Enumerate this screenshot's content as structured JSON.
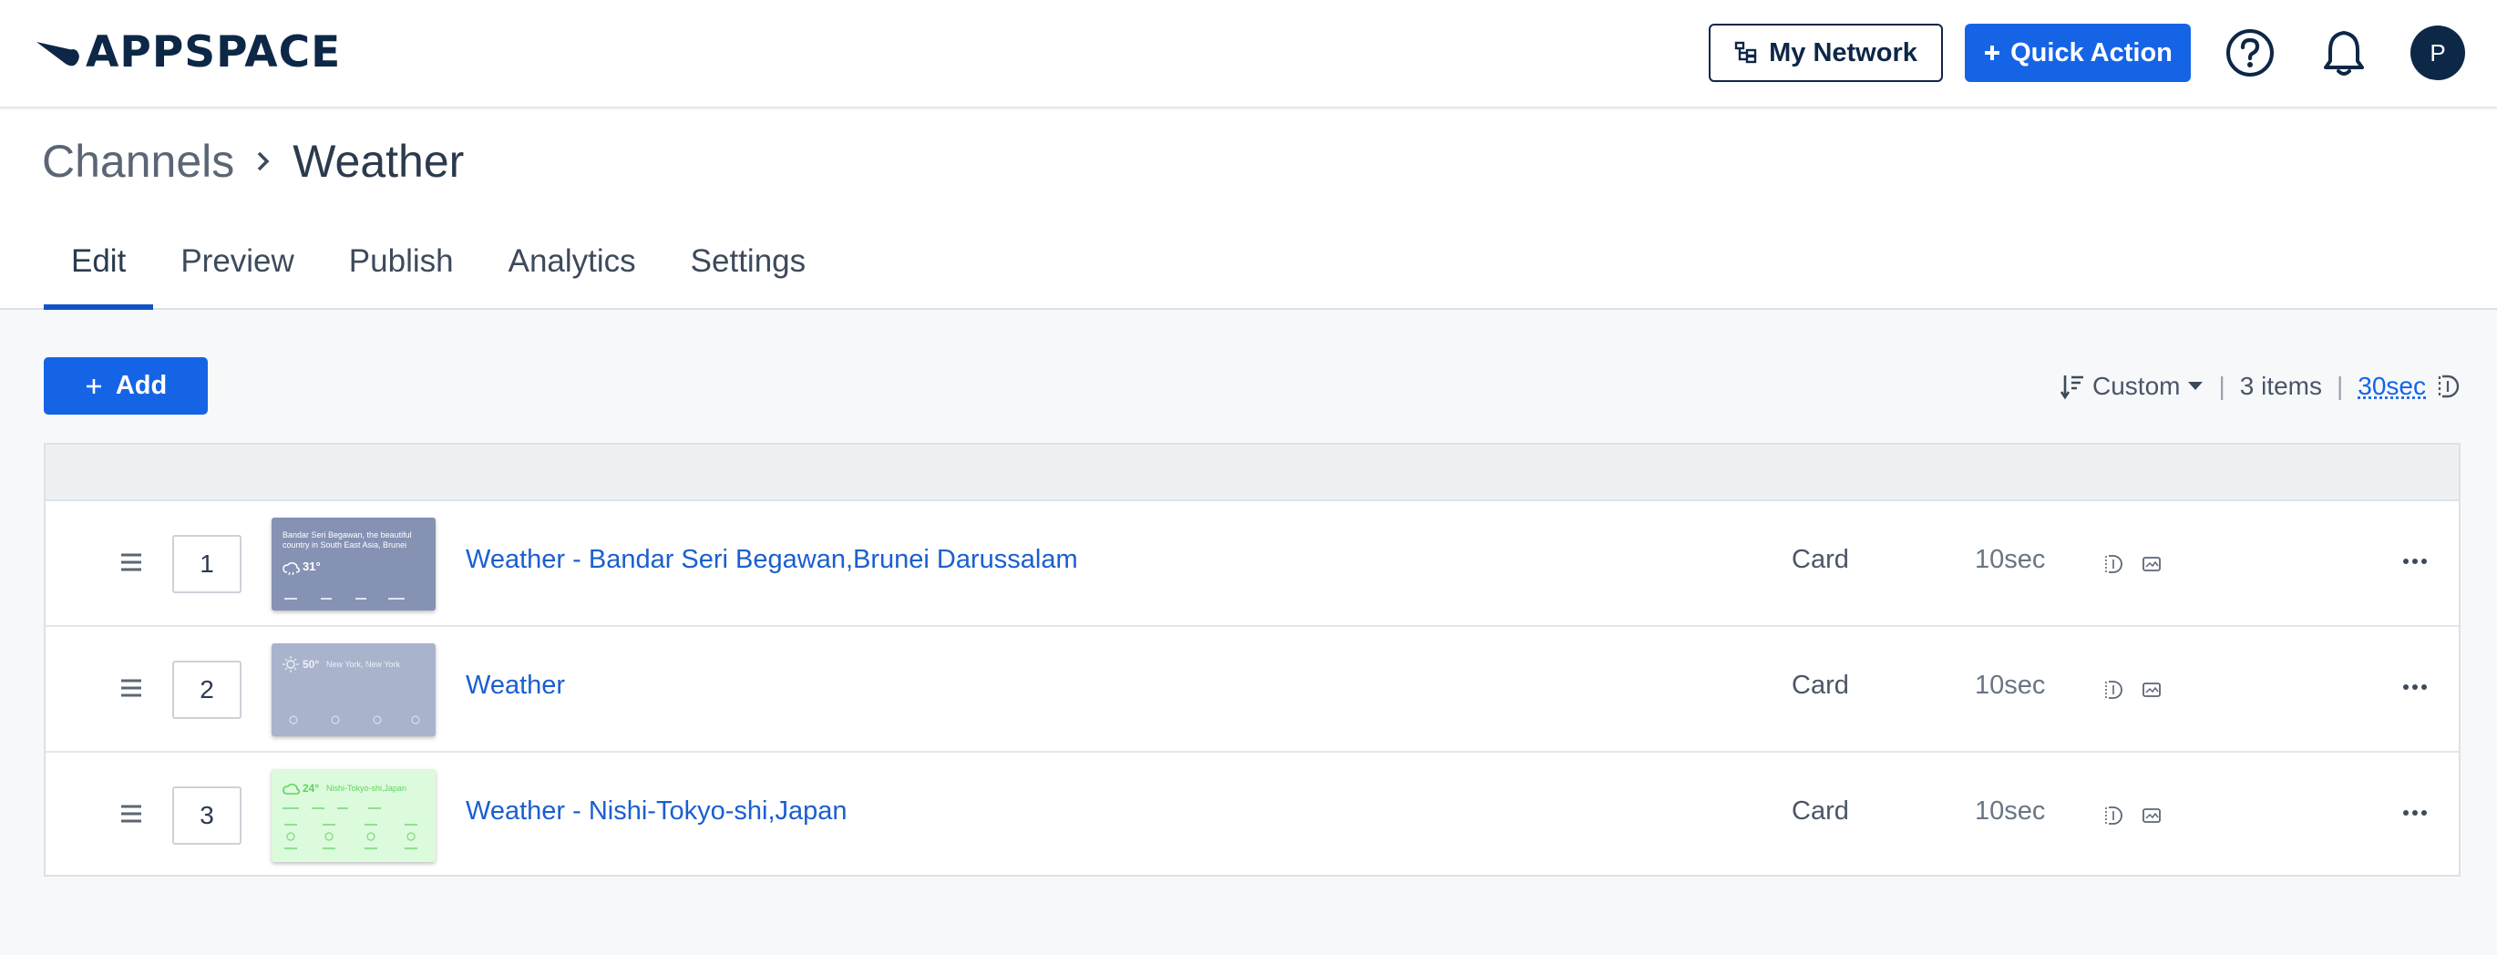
{
  "header": {
    "logo_text": "APPSPACE",
    "my_network_label": "My Network",
    "quick_action_label": "Quick Action",
    "avatar_initial": "P"
  },
  "breadcrumb": {
    "parent": "Channels",
    "current": "Weather"
  },
  "tabs": [
    {
      "label": "Edit",
      "active": true
    },
    {
      "label": "Preview",
      "active": false
    },
    {
      "label": "Publish",
      "active": false
    },
    {
      "label": "Analytics",
      "active": false
    },
    {
      "label": "Settings",
      "active": false
    }
  ],
  "toolbar": {
    "add_label": "Add",
    "sort_label": "Custom",
    "item_count": "3 items",
    "total_duration": "30sec"
  },
  "items": [
    {
      "order": "1",
      "name": "Weather - Bandar Seri Begawan,Brunei Darussalam",
      "type": "Card",
      "duration": "10sec",
      "thumb_text": "Bandar Seri Begawan, the beautiful country in South East Asia, Brunei",
      "thumb_temp": "31°",
      "thumb_bg": "#8592b3",
      "thumb_fg": "#ffffff"
    },
    {
      "order": "2",
      "name": "Weather",
      "type": "Card",
      "duration": "10sec",
      "thumb_text": "New York, New York",
      "thumb_temp": "50°",
      "thumb_bg": "#a9b3cc",
      "thumb_fg": "#eef1f7"
    },
    {
      "order": "3",
      "name": "Weather - Nishi-Tokyo-shi,Japan",
      "type": "Card",
      "duration": "10sec",
      "thumb_text": "Nishi-Tokyo-shi,Japan",
      "thumb_temp": "24°",
      "thumb_bg": "#dcfadc",
      "thumb_fg": "#5fd35f"
    }
  ],
  "colors": {
    "brand": "#0d2747",
    "primary": "#1664e6",
    "link": "#1a5fd0"
  }
}
